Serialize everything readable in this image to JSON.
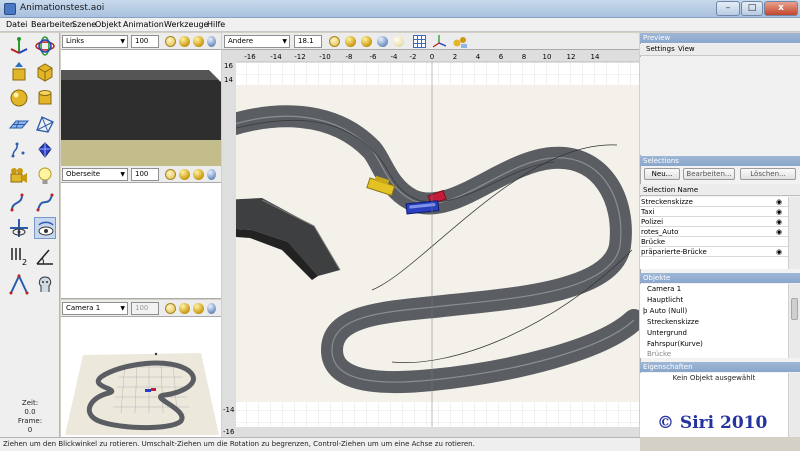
{
  "window": {
    "title": "Animationstest.aoi",
    "min_label": "–",
    "max_label": "□",
    "close_label": "x"
  },
  "menu": [
    "Datei",
    "Bearbeiten",
    "Szene",
    "Objekt",
    "Animation",
    "Werkzeuge",
    "Hilfe"
  ],
  "time": {
    "zeit_label": "Zeit:",
    "zeit_value": "0.0",
    "frame_label": "Frame:",
    "frame_value": "0"
  },
  "viewports": {
    "top_left": {
      "view": "Links",
      "zoom": "100"
    },
    "mid_left": {
      "view": "Oberseite",
      "zoom": "100"
    },
    "bottom_left": {
      "view": "Camera 1",
      "zoom": "100"
    },
    "main": {
      "view": "Andere",
      "zoom": "18.1",
      "ruler_top": [
        "-16",
        "-14",
        "-12",
        "-10",
        "-8",
        "-6",
        "-4",
        "-2",
        "0",
        "2",
        "4",
        "6",
        "8",
        "10",
        "12",
        "14"
      ],
      "ruler_left": [
        "16",
        "14",
        "-14",
        "-16"
      ]
    }
  },
  "preview": {
    "title": "Preview",
    "settings_label": "Settings",
    "view_label": "View"
  },
  "selections": {
    "title": "Selections",
    "new_button": "Neu...",
    "edit_button": "Bearbeiten...",
    "delete_button": "Löschen...",
    "column_header": "Selection Name",
    "rows": [
      {
        "name": "Streckenskizze",
        "visible": true
      },
      {
        "name": "Taxi",
        "visible": true
      },
      {
        "name": "Polizei",
        "visible": true
      },
      {
        "name": "rotes_Auto",
        "visible": true
      },
      {
        "name": "Brücke",
        "visible": false
      },
      {
        "name": "präparierte-Brücke",
        "visible": true
      }
    ]
  },
  "objects": {
    "title": "Objekte",
    "items": [
      "Camera 1",
      "Hauptlicht",
      "þ Auto (Null)",
      "Streckenskizze",
      "Untergrund",
      "Fahrspur(Kurve)",
      "Brücke"
    ]
  },
  "properties": {
    "title": "Eigenschaften",
    "empty_text": "Kein Objekt ausgewählt"
  },
  "statusbar": "Ziehen um den Blickwinkel zu rotieren. Umschalt-Ziehen um die Rotation zu begrenzen, Control-Ziehen um um eine Achse zu rotieren.",
  "watermark": "© Siri 2010",
  "colors": {
    "track": "#5a5e62",
    "floor": "#f2f0e8",
    "grid": "#d3d3d3",
    "taxi": "#e3c323",
    "bus": "#2a3fbf",
    "red_car": "#c41b3a"
  }
}
